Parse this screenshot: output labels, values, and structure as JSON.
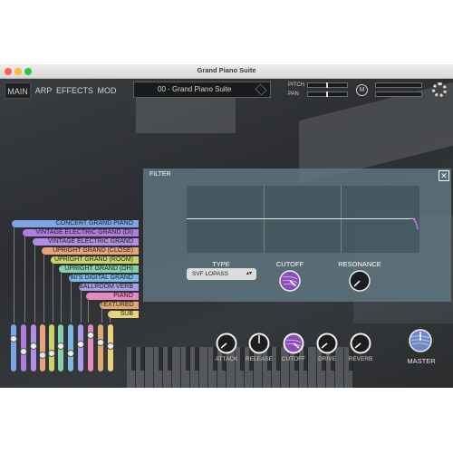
{
  "window": {
    "title": "Grand Piano Suite"
  },
  "nav": {
    "tabs": [
      "MAIN",
      "ARP",
      "EFFECTS",
      "MOD"
    ],
    "active": "MAIN"
  },
  "preset": {
    "name": "00 - Grand Piano Suite"
  },
  "top_controls": {
    "pitch_label": "PITCH",
    "pan_label": "PAN",
    "mono_label": "M"
  },
  "filter": {
    "title": "FILTER",
    "close": "✕",
    "type_label": "TYPE",
    "type_value": "SVF LOPASS",
    "cutoff_label": "CUTOFF",
    "resonance_label": "RESONANCE"
  },
  "layers": [
    {
      "label": "CONCERT GRAND PIANO",
      "color": "#7ea3e8"
    },
    {
      "label": "VINTAGE ELECTRIC GRAND (DI)",
      "color": "#b07ce0"
    },
    {
      "label": "VINTAGE ELECTRIC GRAND (OH)",
      "color": "#b28de6"
    },
    {
      "label": "UPRIGHT GRAND (CLOSE)",
      "color": "#e8a37a"
    },
    {
      "label": "UPRIGHT GRAND (ROOM)",
      "color": "#c8d36a"
    },
    {
      "label": "UPRIGHT GRAND (OH)",
      "color": "#86d0a8"
    },
    {
      "label": "80'S DIGITAL GRAND",
      "color": "#7ab8e8"
    },
    {
      "label": "BALLROOM VERB",
      "color": "#a89ee6"
    },
    {
      "label": "PIANO ATTACKS",
      "color": "#e88ac2"
    },
    {
      "label": "TEXTURED",
      "color": "#e0a870"
    },
    {
      "label": "SUB",
      "color": "#e8d27a"
    }
  ],
  "effect_knobs": [
    "ATTACK",
    "RELEASE",
    "CUTOFF",
    "DRIVE",
    "REVERB"
  ],
  "master": {
    "label": "MASTER"
  },
  "colors": {
    "accent": "#8a4fb8",
    "panel": "#5f7882",
    "window": "#2c2f32"
  }
}
